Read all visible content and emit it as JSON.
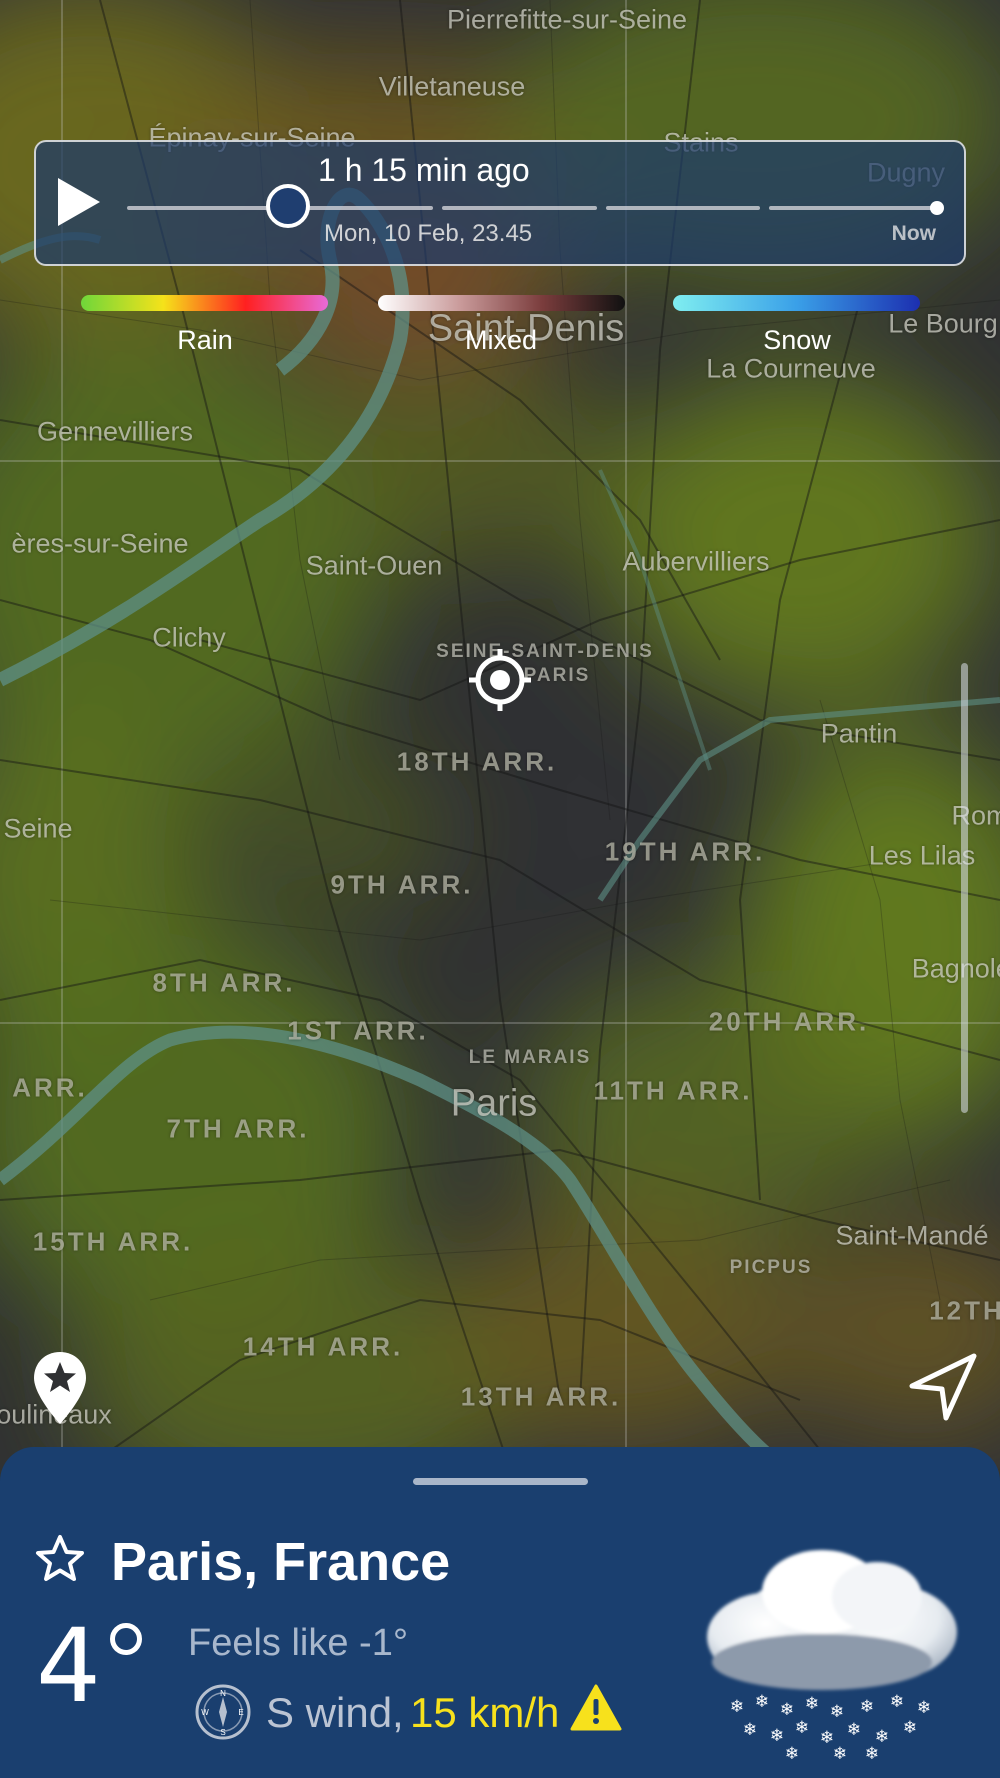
{
  "timeline": {
    "relative_time": "1 h 15 min ago",
    "date_time": "Mon, 10 Feb, 23.45",
    "now_label": "Now",
    "position": 0.2
  },
  "legend": [
    {
      "label": "Rain",
      "gradient": [
        "#6fd63a",
        "#f5e21a",
        "#ff2020",
        "#e86ad8"
      ]
    },
    {
      "label": "Mixed",
      "gradient": [
        "#ffffff",
        "#c99a9a",
        "#7a3c3c",
        "#111111"
      ]
    },
    {
      "label": "Snow",
      "gradient": [
        "#7feef0",
        "#3aa0e8",
        "#1c2fb0"
      ]
    }
  ],
  "map": {
    "places": [
      {
        "name": "Pierrefitte-sur-Seine",
        "style": "city"
      },
      {
        "name": "Villetaneuse",
        "style": "city"
      },
      {
        "name": "Épinay-sur-Seine",
        "style": "city"
      },
      {
        "name": "Stains",
        "style": "city"
      },
      {
        "name": "Dugny",
        "style": "city"
      },
      {
        "name": "Saint-Denis",
        "style": "big"
      },
      {
        "name": "Le Bourg",
        "style": "city"
      },
      {
        "name": "La Courneuve",
        "style": "city"
      },
      {
        "name": "Gennevilliers",
        "style": "city"
      },
      {
        "name": "ères-sur-Seine",
        "style": "city"
      },
      {
        "name": "Saint-Ouen",
        "style": "city"
      },
      {
        "name": "Aubervilliers",
        "style": "city"
      },
      {
        "name": "Clichy",
        "style": "city"
      },
      {
        "name": "SEINE-SAINT-DENIS",
        "style": "small"
      },
      {
        "name": "PARIS",
        "style": "small"
      },
      {
        "name": "Pantin",
        "style": "city"
      },
      {
        "name": "18TH ARR.",
        "style": "arr"
      },
      {
        "name": "Seine",
        "style": "city"
      },
      {
        "name": "Rom",
        "style": "city"
      },
      {
        "name": "Les Lilas",
        "style": "city"
      },
      {
        "name": "19TH ARR.",
        "style": "arr"
      },
      {
        "name": "9TH ARR.",
        "style": "arr"
      },
      {
        "name": "Bagnolet",
        "style": "city"
      },
      {
        "name": "8TH ARR.",
        "style": "arr"
      },
      {
        "name": "1ST ARR.",
        "style": "arr"
      },
      {
        "name": "20TH ARR.",
        "style": "arr"
      },
      {
        "name": "LE MARAIS",
        "style": "small"
      },
      {
        "name": "ARR.",
        "style": "arr"
      },
      {
        "name": "Paris",
        "style": "big"
      },
      {
        "name": "11TH ARR.",
        "style": "arr"
      },
      {
        "name": "7TH ARR.",
        "style": "arr"
      },
      {
        "name": "15TH ARR.",
        "style": "arr"
      },
      {
        "name": "Saint-Mandé",
        "style": "city"
      },
      {
        "name": "PICPUS",
        "style": "small"
      },
      {
        "name": "12TH",
        "style": "arr"
      },
      {
        "name": "14TH ARR.",
        "style": "arr"
      },
      {
        "name": "13TH ARR.",
        "style": "arr"
      },
      {
        "name": "oulineaux",
        "style": "city"
      }
    ]
  },
  "icons": {
    "play": "play-icon",
    "crosshair": "my-location-crosshair-icon",
    "favorite_pin": "favorite-pin-icon",
    "locate": "navigation-arrow-icon",
    "star": "star-outline-icon",
    "compass": "compass-icon",
    "warning": "warning-icon",
    "weather": "snow-cloud-icon"
  },
  "weather": {
    "location": "Paris, France",
    "temperature": "4",
    "feels_like": "Feels like -1°",
    "wind_direction_text": "S wind,",
    "wind_speed": "15 km/h",
    "compass_letters": [
      "N",
      "W",
      "E",
      "S"
    ]
  },
  "colors": {
    "panel_bg": "#1c3a6c",
    "sheet_bg": "#1a3f6f",
    "wind_speed": "#f7e11c",
    "warning": "#f7e11c",
    "map_bg": "#2f3033",
    "river": "#5d8f86"
  }
}
